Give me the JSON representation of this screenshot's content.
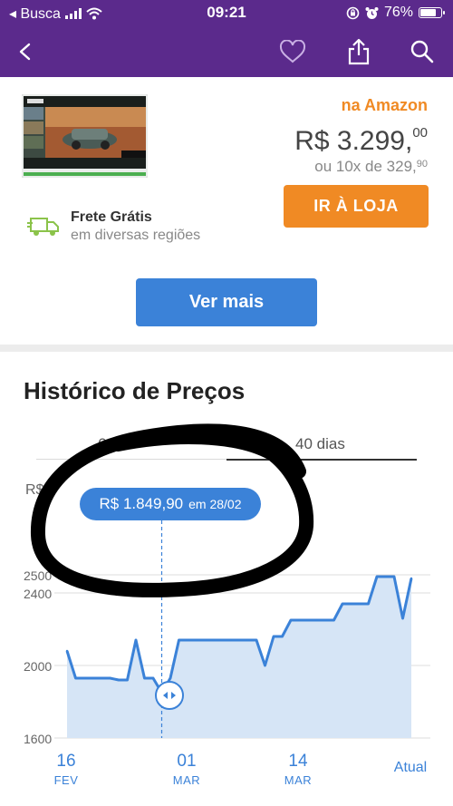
{
  "status_bar": {
    "carrier": "◂ Busca",
    "time": "09:21",
    "battery": "76%",
    "battery_level": 0.76
  },
  "nav": {
    "icons": [
      "back-arrow-icon",
      "heart-icon",
      "share-icon",
      "search-icon"
    ]
  },
  "product": {
    "store": "na Amazon",
    "price_main": "R$ 3.299,",
    "price_cents": "00",
    "installments_text": "ou 10x de 329,",
    "installments_cents": "90",
    "store_button": "IR À LOJA",
    "shipping_title": "Frete Grátis",
    "shipping_subtitle": "em diversas regiões",
    "more_button": "Ver mais"
  },
  "history": {
    "title": "Histórico de Preços",
    "tabs": [
      "6",
      "40 dias"
    ],
    "active_tab": "40 dias",
    "currency": "R$",
    "tooltip_value": "R$ 1.849,90",
    "tooltip_date": "em 28/02",
    "x_ticks": [
      {
        "day": "16",
        "month": "FEV"
      },
      {
        "day": "01",
        "month": "MAR"
      },
      {
        "day": "14",
        "month": "MAR"
      },
      {
        "day": "Atual",
        "month": ""
      }
    ],
    "colors": {
      "line": "#3b82d8",
      "fill": "#d6e5f6",
      "accent": "#5b2a8c",
      "store_button": "#f08a24"
    }
  },
  "chart_data": {
    "type": "area",
    "ylim": [
      1600,
      2500
    ],
    "y_ticks": [
      1600,
      2000,
      2400,
      2500
    ],
    "grid": true,
    "selected_point": {
      "index": 11,
      "value": 1849.9,
      "date": "28/02"
    },
    "values": [
      2080,
      1930,
      1930,
      1930,
      1930,
      1930,
      1920,
      1920,
      2140,
      1930,
      1930,
      1850,
      1930,
      2140,
      2140,
      2140,
      2140,
      2140,
      2140,
      2140,
      2140,
      2140,
      2140,
      2000,
      2160,
      2160,
      2250,
      2250,
      2250,
      2250,
      2250,
      2250,
      2340,
      2340,
      2340,
      2340,
      2490,
      2490,
      2490,
      2260,
      2480
    ]
  }
}
